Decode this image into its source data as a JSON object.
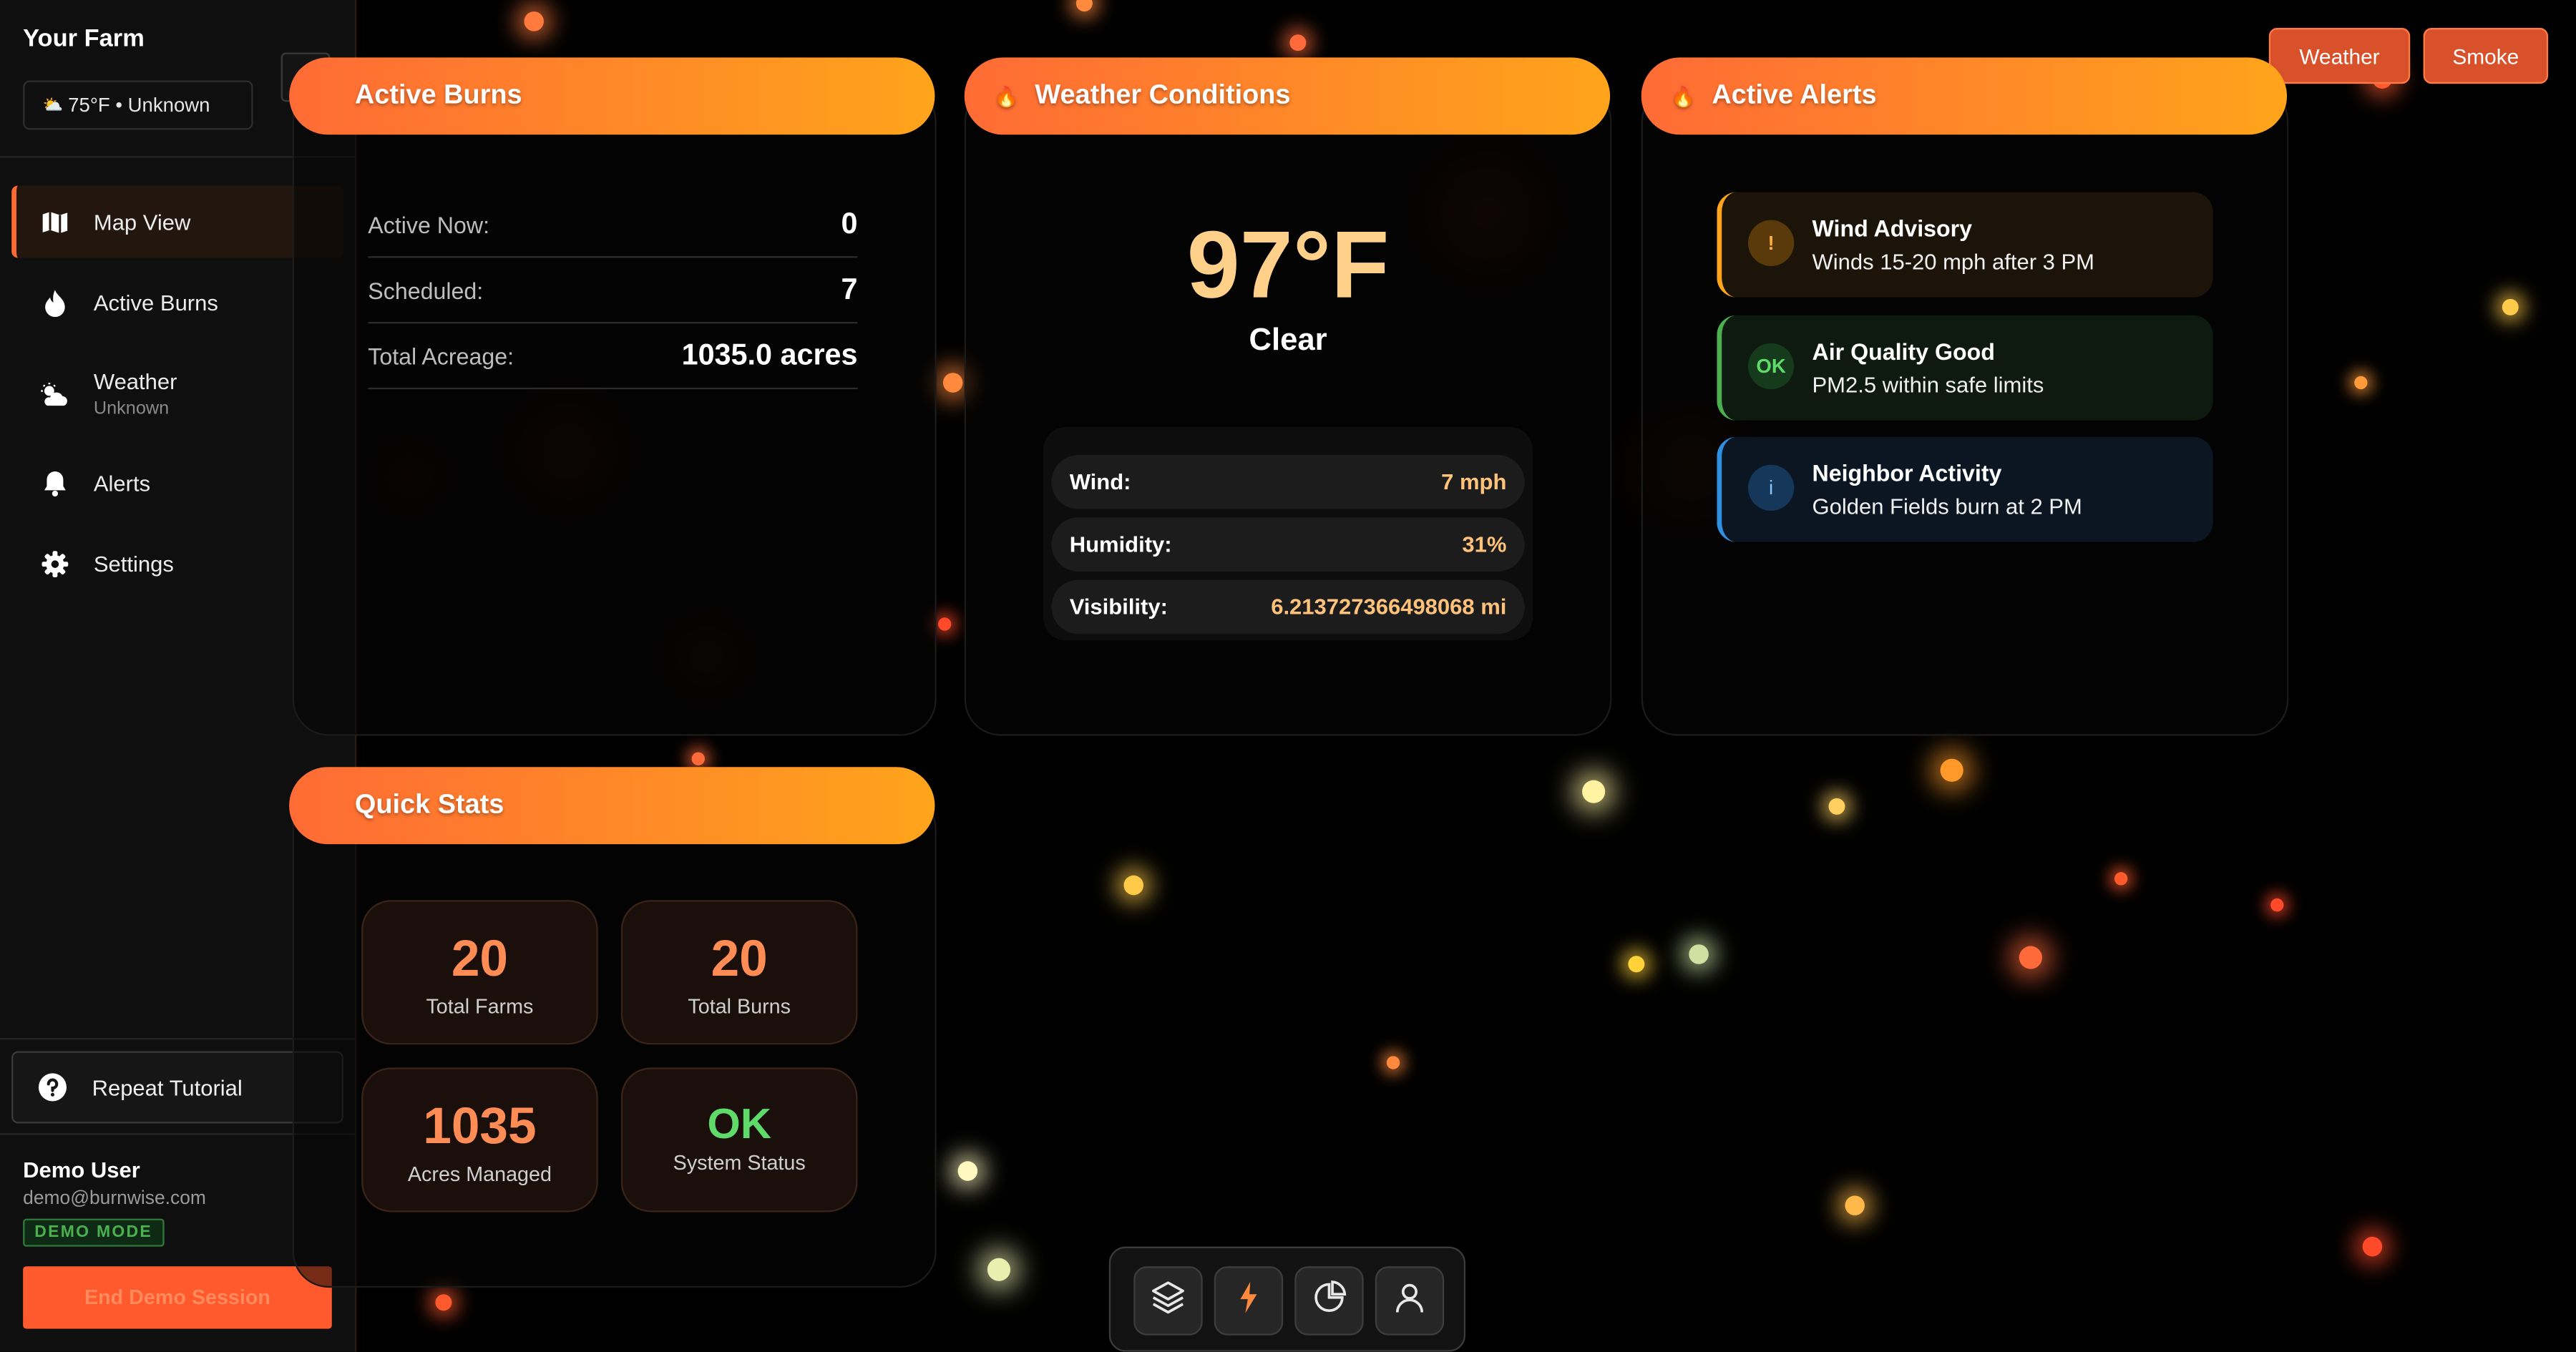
{
  "sidebar": {
    "farm_title": "Your Farm",
    "farm_weather_icon": "⛅",
    "farm_weather": "75°F • Unknown",
    "close_label": "✕",
    "nav": [
      {
        "label": "Map View",
        "icon": "map-icon",
        "active": true
      },
      {
        "label": "Active Burns",
        "icon": "flame-icon"
      },
      {
        "label": "Weather",
        "sublabel": "Unknown",
        "icon": "cloud-sun-icon"
      },
      {
        "label": "Alerts",
        "icon": "bell-icon"
      },
      {
        "label": "Settings",
        "icon": "gear-icon"
      }
    ],
    "tutorial_label": "Repeat Tutorial",
    "user": {
      "name": "Demo User",
      "email": "demo@burnwise.com",
      "badge": "DEMO MODE"
    },
    "end_session_label": "End Demo Session"
  },
  "top_buttons": {
    "weather": "Weather",
    "smoke": "Smoke"
  },
  "active_burns": {
    "title": "Active Burns",
    "rows": [
      {
        "label": "Active Now:",
        "value": "0"
      },
      {
        "label": "Scheduled:",
        "value": "7"
      },
      {
        "label": "Total Acreage:",
        "value": "1035.0 acres"
      }
    ]
  },
  "weather": {
    "title": "Weather Conditions",
    "temperature": "97°F",
    "condition": "Clear",
    "rows": [
      {
        "label": "Wind:",
        "value": "7 mph"
      },
      {
        "label": "Humidity:",
        "value": "31%"
      },
      {
        "label": "Visibility:",
        "value": "6.213727366498068 mi"
      }
    ]
  },
  "alerts": {
    "title": "Active Alerts",
    "items": [
      {
        "icon_text": "!",
        "title": "Wind Advisory",
        "description": "Winds 15-20 mph after 3 PM",
        "color": "#ffa41b"
      },
      {
        "icon_text": "OK",
        "title": "Air Quality Good",
        "description": "PM2.5 within safe limits",
        "color": "#4caf50"
      },
      {
        "icon_text": "i",
        "title": "Neighbor Activity",
        "description": "Golden Fields burn at 2 PM",
        "color": "#2f8fe0"
      }
    ]
  },
  "quick_stats": {
    "title": "Quick Stats",
    "cards": [
      {
        "value": "20",
        "label": "Total Farms"
      },
      {
        "value": "20",
        "label": "Total Burns"
      },
      {
        "value": "1035",
        "label": "Acres Managed"
      },
      {
        "value": "OK",
        "label": "System Status"
      }
    ]
  },
  "dock": {
    "buttons": [
      "layers-icon",
      "flame-icon",
      "chart-icon",
      "user-icon"
    ]
  },
  "colors": {
    "accent": "#ff6b35",
    "accent_end": "#ffa41b",
    "ok": "#5fdb6a",
    "temperature": "#ffd08a"
  }
}
